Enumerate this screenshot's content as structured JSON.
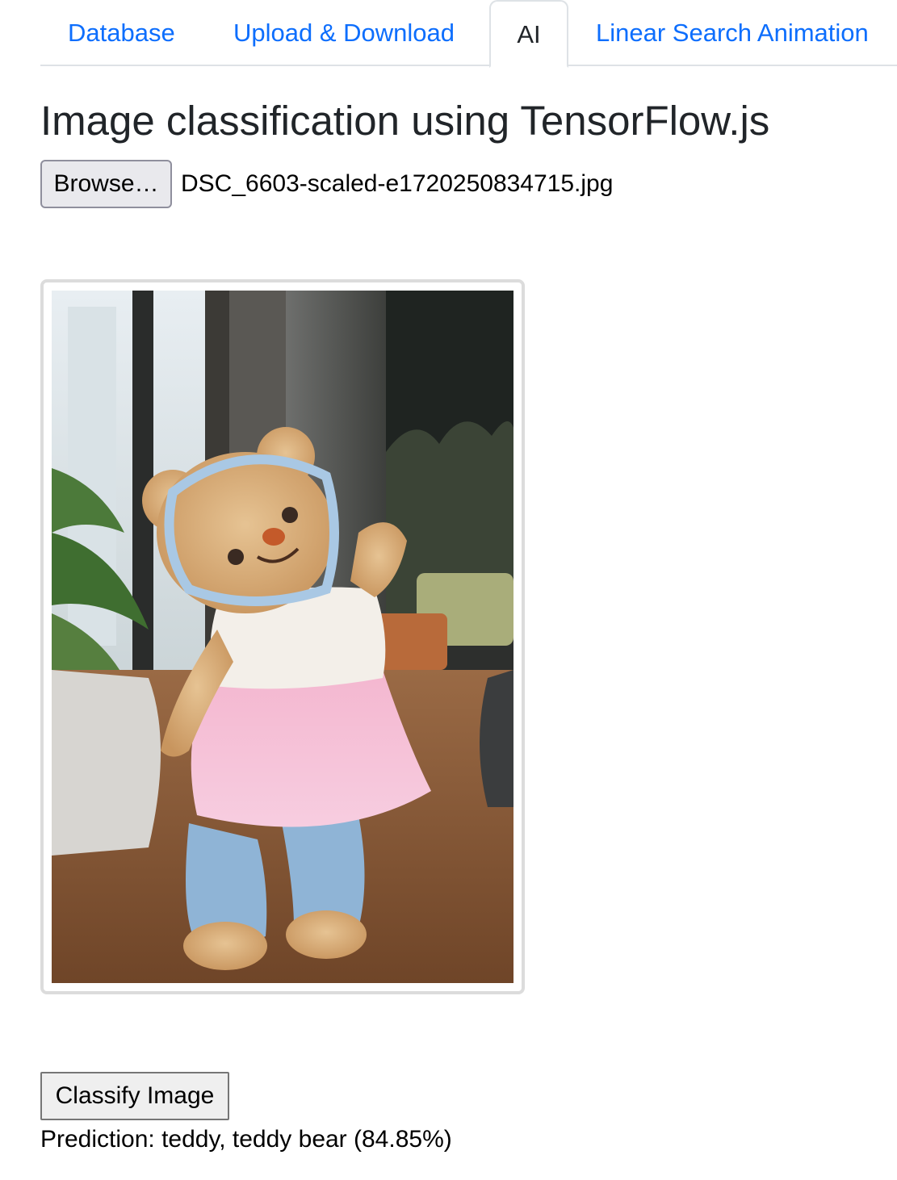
{
  "tabs": [
    {
      "label": "Database",
      "active": false
    },
    {
      "label": "Upload & Download",
      "active": false
    },
    {
      "label": "AI",
      "active": true
    },
    {
      "label": "Linear Search Animation",
      "active": false
    }
  ],
  "page_title": "Image classification using TensorFlow.js",
  "file_input": {
    "button_label": "Browse…",
    "selected_file": "DSC_6603-scaled-e1720250834715.jpg"
  },
  "classify_button_label": "Classify Image",
  "prediction_text": "Prediction: teddy, teddy bear (84.85%)",
  "colors": {
    "link": "#0d6efd",
    "text": "#212529",
    "tab_border": "#dee2e6"
  }
}
